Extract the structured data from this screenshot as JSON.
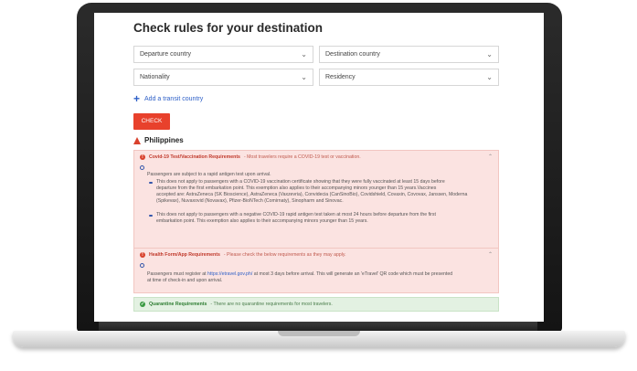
{
  "page": {
    "title": "Check rules for your destination"
  },
  "form": {
    "departure_country": "Departure country",
    "destination_country": "Destination country",
    "nationality": "Nationality",
    "residency": "Residency",
    "add_transit": "Add a transit country",
    "check_button": "CHECK"
  },
  "result": {
    "country": "Philippines",
    "covid": {
      "title": "Covid-19 Test/Vaccination Requirements",
      "summary": "- Most travelers require a COVID-19 test or vaccination.",
      "intro": "Passengers are subject to a rapid antigen test upon arrival.",
      "bullet1_line1": "This does not apply to passengers with a COVID-19 vaccination certificate showing that they were fully vaccinated at least 15 days before",
      "bullet1_line2": "departure from the first embarkation point. This exemption also applies to their accompanying minors younger than 15 years.Vaccines",
      "bullet1_line3": "accepted are: AstraZeneca (SK Bioscience), AstraZeneca (Vaxzevria), Convidecia (CanSinoBio), Covidshield, Covaxin, Covovax, Janssen, Moderna",
      "bullet1_line4": "(Spikevax), Nuvaxovid (Novavax), Pfizer-BioNTech (Comirnaty), Sinopharm and Sinovac.",
      "bullet2_line1": "This does not apply to passengers with a negative COVID-19 rapid antigen test taken at most 24 hours before departure from the first",
      "bullet2_line2": "embarkation point. This exemption also applies to their accompanying minors younger than 15 years."
    },
    "health": {
      "title": "Health Form/App Requirements",
      "summary": "- Please check the below requirements as they may apply.",
      "text_pre": "Passengers must register at",
      "link": "https://etravel.gov.ph/",
      "text_post": "at most 3 days before arrival. This will generate an 'eTravel' QR code which must be presented",
      "text_line2": "at time of check-in and upon arrival."
    },
    "quarantine": {
      "title": "Quarantine Requirements",
      "summary": "- There are no quarantine requirements for most travelers."
    }
  },
  "colors": {
    "accent": "#e8412c",
    "link": "#2d5fc7",
    "alert_bg": "#fbe3e1",
    "ok_bg": "#e3f1e2"
  }
}
